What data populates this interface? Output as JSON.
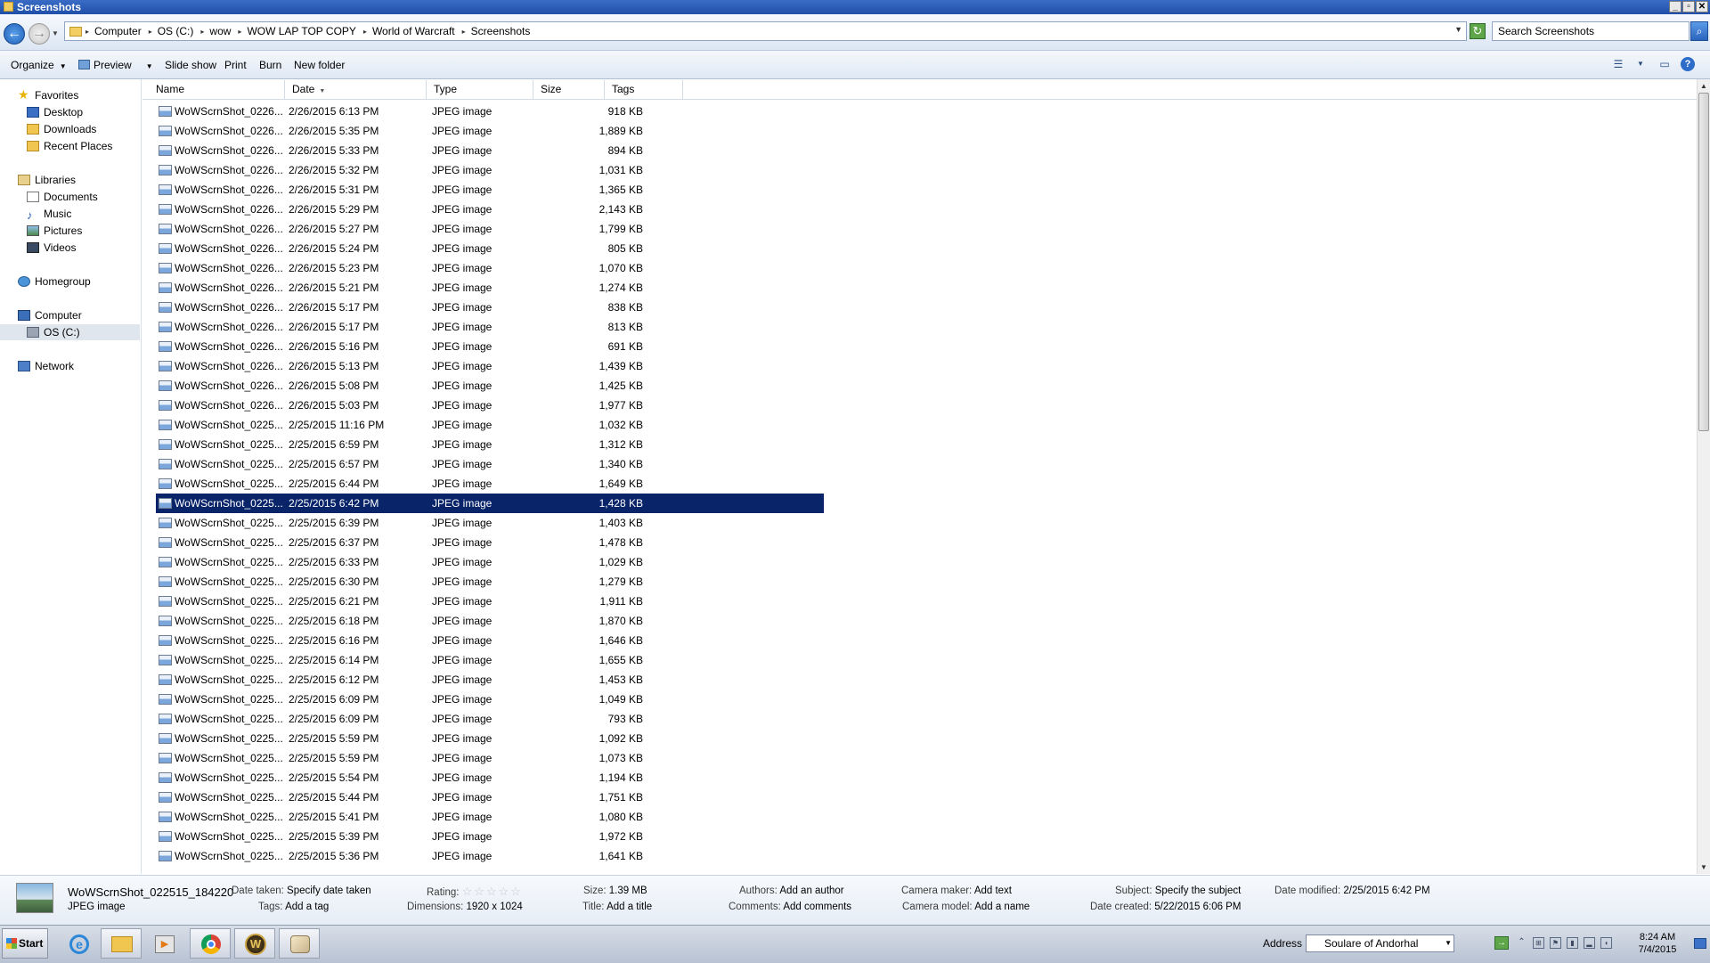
{
  "window": {
    "title": "Screenshots",
    "controls": {
      "minimize": "_",
      "maximize": "▫",
      "close": "✕"
    }
  },
  "address_bar": {
    "crumbs": [
      "Computer",
      "OS (C:)",
      "wow",
      "WOW LAP TOP COPY",
      "World of Warcraft",
      "Screenshots"
    ],
    "search_placeholder": "Search Screenshots"
  },
  "toolbar": {
    "organize": "Organize",
    "preview": "Preview",
    "slideshow": "Slide show",
    "print": "Print",
    "burn": "Burn",
    "new_folder": "New folder"
  },
  "nav": {
    "favorites": "Favorites",
    "desktop": "Desktop",
    "downloads": "Downloads",
    "recent": "Recent Places",
    "libraries": "Libraries",
    "documents": "Documents",
    "music": "Music",
    "pictures": "Pictures",
    "videos": "Videos",
    "homegroup": "Homegroup",
    "computer": "Computer",
    "osc": "OS (C:)",
    "network": "Network"
  },
  "columns": {
    "name": "Name",
    "date": "Date",
    "type": "Type",
    "size": "Size",
    "tags": "Tags"
  },
  "files": [
    {
      "name": "WoWScrnShot_0226...",
      "date": "2/26/2015 6:13 PM",
      "type": "JPEG image",
      "size": "918 KB"
    },
    {
      "name": "WoWScrnShot_0226...",
      "date": "2/26/2015 5:35 PM",
      "type": "JPEG image",
      "size": "1,889 KB"
    },
    {
      "name": "WoWScrnShot_0226...",
      "date": "2/26/2015 5:33 PM",
      "type": "JPEG image",
      "size": "894 KB"
    },
    {
      "name": "WoWScrnShot_0226...",
      "date": "2/26/2015 5:32 PM",
      "type": "JPEG image",
      "size": "1,031 KB"
    },
    {
      "name": "WoWScrnShot_0226...",
      "date": "2/26/2015 5:31 PM",
      "type": "JPEG image",
      "size": "1,365 KB"
    },
    {
      "name": "WoWScrnShot_0226...",
      "date": "2/26/2015 5:29 PM",
      "type": "JPEG image",
      "size": "2,143 KB"
    },
    {
      "name": "WoWScrnShot_0226...",
      "date": "2/26/2015 5:27 PM",
      "type": "JPEG image",
      "size": "1,799 KB"
    },
    {
      "name": "WoWScrnShot_0226...",
      "date": "2/26/2015 5:24 PM",
      "type": "JPEG image",
      "size": "805 KB"
    },
    {
      "name": "WoWScrnShot_0226...",
      "date": "2/26/2015 5:23 PM",
      "type": "JPEG image",
      "size": "1,070 KB"
    },
    {
      "name": "WoWScrnShot_0226...",
      "date": "2/26/2015 5:21 PM",
      "type": "JPEG image",
      "size": "1,274 KB"
    },
    {
      "name": "WoWScrnShot_0226...",
      "date": "2/26/2015 5:17 PM",
      "type": "JPEG image",
      "size": "838 KB"
    },
    {
      "name": "WoWScrnShot_0226...",
      "date": "2/26/2015 5:17 PM",
      "type": "JPEG image",
      "size": "813 KB"
    },
    {
      "name": "WoWScrnShot_0226...",
      "date": "2/26/2015 5:16 PM",
      "type": "JPEG image",
      "size": "691 KB"
    },
    {
      "name": "WoWScrnShot_0226...",
      "date": "2/26/2015 5:13 PM",
      "type": "JPEG image",
      "size": "1,439 KB"
    },
    {
      "name": "WoWScrnShot_0226...",
      "date": "2/26/2015 5:08 PM",
      "type": "JPEG image",
      "size": "1,425 KB"
    },
    {
      "name": "WoWScrnShot_0226...",
      "date": "2/26/2015 5:03 PM",
      "type": "JPEG image",
      "size": "1,977 KB"
    },
    {
      "name": "WoWScrnShot_0225...",
      "date": "2/25/2015 11:16 PM",
      "type": "JPEG image",
      "size": "1,032 KB"
    },
    {
      "name": "WoWScrnShot_0225...",
      "date": "2/25/2015 6:59 PM",
      "type": "JPEG image",
      "size": "1,312 KB"
    },
    {
      "name": "WoWScrnShot_0225...",
      "date": "2/25/2015 6:57 PM",
      "type": "JPEG image",
      "size": "1,340 KB"
    },
    {
      "name": "WoWScrnShot_0225...",
      "date": "2/25/2015 6:44 PM",
      "type": "JPEG image",
      "size": "1,649 KB"
    },
    {
      "name": "WoWScrnShot_0225...",
      "date": "2/25/2015 6:42 PM",
      "type": "JPEG image",
      "size": "1,428 KB",
      "selected": true
    },
    {
      "name": "WoWScrnShot_0225...",
      "date": "2/25/2015 6:39 PM",
      "type": "JPEG image",
      "size": "1,403 KB"
    },
    {
      "name": "WoWScrnShot_0225...",
      "date": "2/25/2015 6:37 PM",
      "type": "JPEG image",
      "size": "1,478 KB"
    },
    {
      "name": "WoWScrnShot_0225...",
      "date": "2/25/2015 6:33 PM",
      "type": "JPEG image",
      "size": "1,029 KB"
    },
    {
      "name": "WoWScrnShot_0225...",
      "date": "2/25/2015 6:30 PM",
      "type": "JPEG image",
      "size": "1,279 KB"
    },
    {
      "name": "WoWScrnShot_0225...",
      "date": "2/25/2015 6:21 PM",
      "type": "JPEG image",
      "size": "1,911 KB"
    },
    {
      "name": "WoWScrnShot_0225...",
      "date": "2/25/2015 6:18 PM",
      "type": "JPEG image",
      "size": "1,870 KB"
    },
    {
      "name": "WoWScrnShot_0225...",
      "date": "2/25/2015 6:16 PM",
      "type": "JPEG image",
      "size": "1,646 KB"
    },
    {
      "name": "WoWScrnShot_0225...",
      "date": "2/25/2015 6:14 PM",
      "type": "JPEG image",
      "size": "1,655 KB"
    },
    {
      "name": "WoWScrnShot_0225...",
      "date": "2/25/2015 6:12 PM",
      "type": "JPEG image",
      "size": "1,453 KB"
    },
    {
      "name": "WoWScrnShot_0225...",
      "date": "2/25/2015 6:09 PM",
      "type": "JPEG image",
      "size": "1,049 KB"
    },
    {
      "name": "WoWScrnShot_0225...",
      "date": "2/25/2015 6:09 PM",
      "type": "JPEG image",
      "size": "793 KB"
    },
    {
      "name": "WoWScrnShot_0225...",
      "date": "2/25/2015 5:59 PM",
      "type": "JPEG image",
      "size": "1,092 KB"
    },
    {
      "name": "WoWScrnShot_0225...",
      "date": "2/25/2015 5:59 PM",
      "type": "JPEG image",
      "size": "1,073 KB"
    },
    {
      "name": "WoWScrnShot_0225...",
      "date": "2/25/2015 5:54 PM",
      "type": "JPEG image",
      "size": "1,194 KB"
    },
    {
      "name": "WoWScrnShot_0225...",
      "date": "2/25/2015 5:44 PM",
      "type": "JPEG image",
      "size": "1,751 KB"
    },
    {
      "name": "WoWScrnShot_0225...",
      "date": "2/25/2015 5:41 PM",
      "type": "JPEG image",
      "size": "1,080 KB"
    },
    {
      "name": "WoWScrnShot_0225...",
      "date": "2/25/2015 5:39 PM",
      "type": "JPEG image",
      "size": "1,972 KB"
    },
    {
      "name": "WoWScrnShot_0225...",
      "date": "2/25/2015 5:36 PM",
      "type": "JPEG image",
      "size": "1,641 KB"
    }
  ],
  "details": {
    "filename": "WoWScrnShot_022515_184220",
    "filetype": "JPEG image",
    "date_taken_label": "Date taken:",
    "date_taken": "Specify date taken",
    "tags_label": "Tags:",
    "tags": "Add a tag",
    "rating_label": "Rating:",
    "rating_stars": "☆☆☆☆☆",
    "dimensions_label": "Dimensions:",
    "dimensions": "1920 x 1024",
    "size_label": "Size:",
    "size": "1.39 MB",
    "title_label": "Title:",
    "title": "Add a title",
    "authors_label": "Authors:",
    "authors": "Add an author",
    "comments_label": "Comments:",
    "comments": "Add comments",
    "camera_maker_label": "Camera maker:",
    "camera_maker": "Add text",
    "camera_model_label": "Camera model:",
    "camera_model": "Add a name",
    "subject_label": "Subject:",
    "subject": "Specify the subject",
    "date_created_label": "Date created:",
    "date_created": "5/22/2015 6:06 PM",
    "date_modified_label": "Date modified:",
    "date_modified": "2/25/2015 6:42 PM"
  },
  "taskbar": {
    "start": "Start",
    "address_label": "Address",
    "address_value": "Soulare of Andorhal",
    "time": "8:24 AM",
    "date": "7/4/2015"
  },
  "colors": {
    "selection": "#0a246a",
    "accent": "#1f4fa8"
  }
}
